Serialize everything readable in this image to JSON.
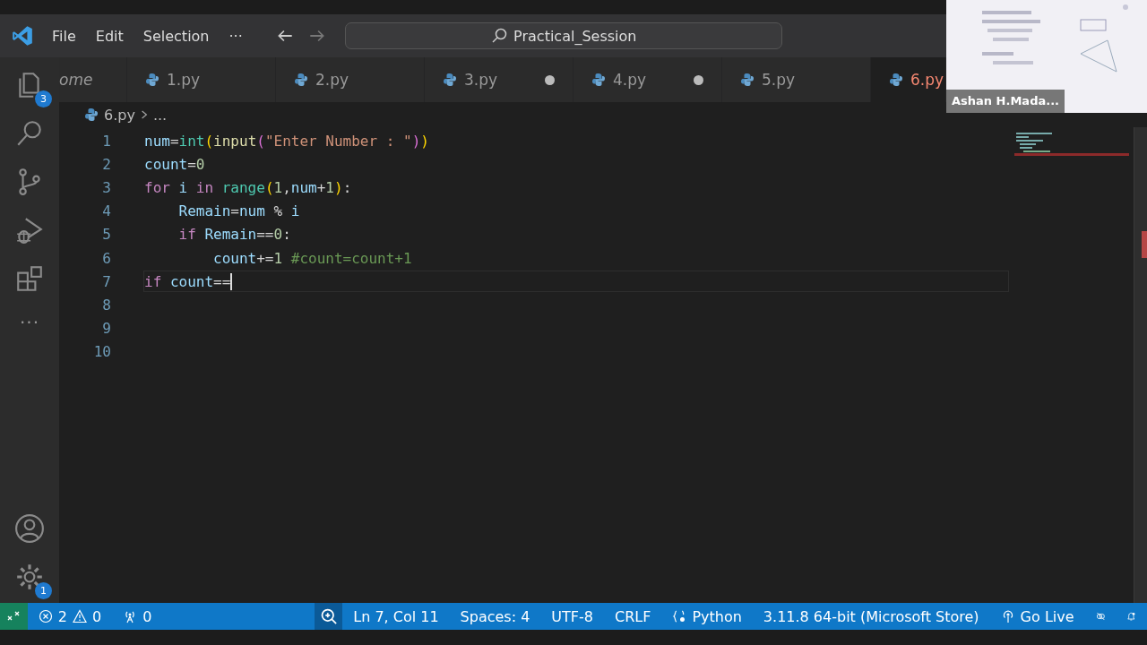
{
  "title_bar": {
    "menu": [
      "File",
      "Edit",
      "Selection",
      "···"
    ],
    "search": {
      "value": "Practical_Session"
    }
  },
  "activity_bar": {
    "explorer_badge": "3",
    "more": "···",
    "settings_badge": "1"
  },
  "tabs": [
    {
      "label": "ome",
      "kind": "welcome",
      "selected": false,
      "modified": false,
      "has_error": false
    },
    {
      "label": "1.py",
      "kind": "python",
      "selected": false,
      "modified": false,
      "has_error": false
    },
    {
      "label": "2.py",
      "kind": "python",
      "selected": false,
      "modified": false,
      "has_error": false
    },
    {
      "label": "3.py",
      "kind": "python",
      "selected": false,
      "modified": true,
      "has_error": false
    },
    {
      "label": "4.py",
      "kind": "python",
      "selected": false,
      "modified": true,
      "has_error": false
    },
    {
      "label": "5.py",
      "kind": "python",
      "selected": false,
      "modified": false,
      "has_error": false
    },
    {
      "label": "6.py",
      "kind": "python",
      "selected": true,
      "modified": false,
      "has_error": true
    }
  ],
  "breadcrumb": {
    "file": "6.py",
    "rest": "..."
  },
  "code_lines": [
    {
      "number": "1",
      "current": false,
      "tokens": [
        {
          "text": "num",
          "kind": "var"
        },
        {
          "text": "=",
          "kind": "op"
        },
        {
          "text": "int",
          "kind": "cls"
        },
        {
          "text": "(",
          "kind": "p1"
        },
        {
          "text": "input",
          "kind": "fn"
        },
        {
          "text": "(",
          "kind": "p2"
        },
        {
          "text": "\"Enter Number : \"",
          "kind": "str"
        },
        {
          "text": ")",
          "kind": "p2"
        },
        {
          "text": ")",
          "kind": "p1"
        }
      ]
    },
    {
      "number": "2",
      "current": false,
      "tokens": [
        {
          "text": "count",
          "kind": "var"
        },
        {
          "text": "=",
          "kind": "op"
        },
        {
          "text": "0",
          "kind": "num"
        }
      ]
    },
    {
      "number": "3",
      "current": false,
      "tokens": [
        {
          "text": "for",
          "kind": "kw"
        },
        {
          "text": " i",
          "kind": "var"
        },
        {
          "text": " in",
          "kind": "kw"
        },
        {
          "text": " range",
          "kind": "cls"
        },
        {
          "text": "(",
          "kind": "p1"
        },
        {
          "text": "1",
          "kind": "num"
        },
        {
          "text": ",",
          "kind": "op"
        },
        {
          "text": "num",
          "kind": "var"
        },
        {
          "text": "+",
          "kind": "op"
        },
        {
          "text": "1",
          "kind": "num"
        },
        {
          "text": ")",
          "kind": "p1"
        },
        {
          "text": ":",
          "kind": "op"
        }
      ]
    },
    {
      "number": "4",
      "current": false,
      "tokens": [
        {
          "text": "    Remain",
          "kind": "var"
        },
        {
          "text": "=",
          "kind": "op"
        },
        {
          "text": "num",
          "kind": "var"
        },
        {
          "text": " % ",
          "kind": "op"
        },
        {
          "text": "i",
          "kind": "var"
        }
      ]
    },
    {
      "number": "5",
      "current": false,
      "tokens": [
        {
          "text": "    if",
          "kind": "kw"
        },
        {
          "text": " Remain",
          "kind": "var"
        },
        {
          "text": "==",
          "kind": "op"
        },
        {
          "text": "0",
          "kind": "num"
        },
        {
          "text": ":",
          "kind": "op"
        }
      ]
    },
    {
      "number": "6",
      "current": false,
      "tokens": [
        {
          "text": "        count",
          "kind": "var"
        },
        {
          "text": "+=",
          "kind": "op"
        },
        {
          "text": "1",
          "kind": "num"
        },
        {
          "text": " #count=count+1",
          "kind": "comment"
        }
      ]
    },
    {
      "number": "7",
      "current": true,
      "tokens": [
        {
          "text": "if",
          "kind": "kw"
        },
        {
          "text": " count",
          "kind": "var"
        },
        {
          "text": "==",
          "kind": "op"
        }
      ]
    },
    {
      "number": "8",
      "current": false
    },
    {
      "number": "9",
      "current": false
    },
    {
      "number": "10",
      "current": false
    }
  ],
  "status_bar": {
    "errors": "2",
    "warnings": "0",
    "ports": "0",
    "position": "Ln 7, Col 11",
    "spaces": "Spaces: 4",
    "encoding": "UTF-8",
    "eol": "CRLF",
    "language": "Python",
    "interpreter": "3.11.8 64-bit (Microsoft Store)",
    "go_live": "Go Live"
  },
  "video_overlay": {
    "name": "Ashan H.Mada..."
  }
}
